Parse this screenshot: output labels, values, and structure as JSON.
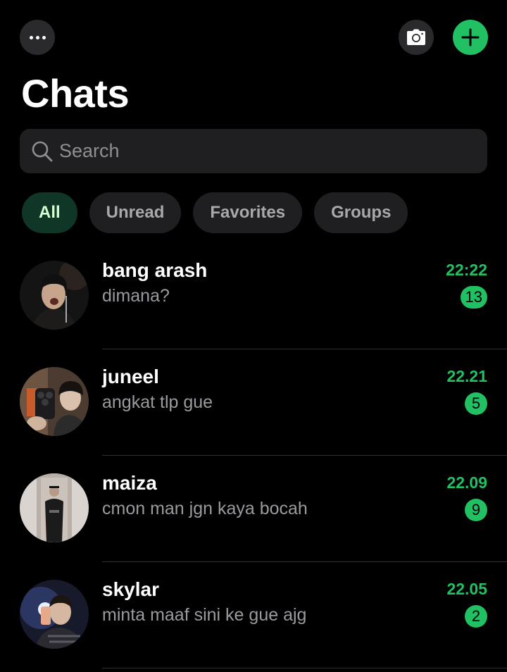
{
  "header": {
    "title": "Chats",
    "more_icon": "ellipsis-icon",
    "camera_icon": "camera-icon",
    "new_icon": "plus-icon",
    "accent": "#21c063"
  },
  "search": {
    "placeholder": "Search"
  },
  "filters": [
    {
      "label": "All",
      "active": true
    },
    {
      "label": "Unread",
      "active": false
    },
    {
      "label": "Favorites",
      "active": false
    },
    {
      "label": "Groups",
      "active": false
    }
  ],
  "chats": [
    {
      "name": "bang arash",
      "message": "dimana?",
      "time": "22:22",
      "unread": "13"
    },
    {
      "name": "juneel",
      "message": "angkat tlp gue",
      "time": "22.21",
      "unread": "5"
    },
    {
      "name": "maiza",
      "message": "cmon man jgn kaya bocah",
      "time": "22.09",
      "unread": "9"
    },
    {
      "name": "skylar",
      "message": "minta maaf sini ke gue ajg",
      "time": "22.05",
      "unread": "2"
    }
  ]
}
